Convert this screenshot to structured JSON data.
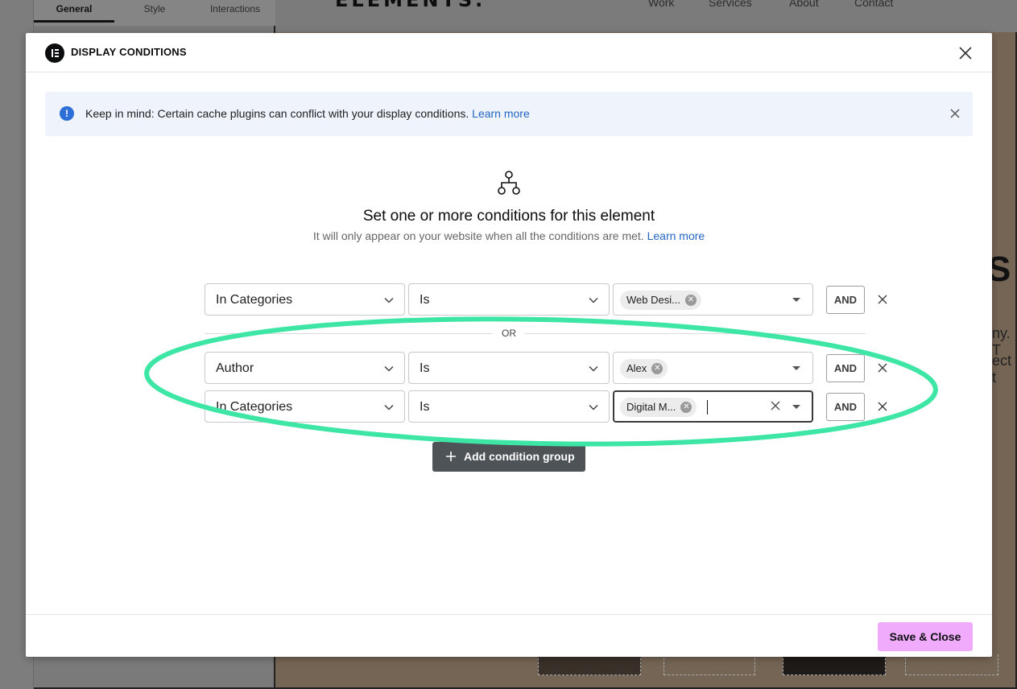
{
  "background": {
    "editor_tabs": [
      "General",
      "Style",
      "Interactions"
    ],
    "site_logo": "ELEMENTS.",
    "site_nav": [
      "Work",
      "Services",
      "About",
      "Contact"
    ],
    "site_text_big": "S",
    "site_text_line1": "ny. T",
    "site_text_line2": "ect t"
  },
  "modal": {
    "title": "DISPLAY CONDITIONS",
    "notice": {
      "text": "Keep in mind: Certain cache plugins can conflict with your display conditions.",
      "link": "Learn more"
    },
    "hero": {
      "title": "Set one or more conditions for this element",
      "subtitle": "It will only appear on your website when all the conditions are met.",
      "link": "Learn more"
    },
    "separator_label": "OR",
    "groups": [
      {
        "rows": [
          {
            "condition": "In Categories",
            "operator": "Is",
            "values": [
              "Web Desi..."
            ],
            "and_label": "AND"
          }
        ]
      },
      {
        "rows": [
          {
            "condition": "Author",
            "operator": "Is",
            "values": [
              "Alex"
            ],
            "and_label": "AND"
          },
          {
            "condition": "In Categories",
            "operator": "Is",
            "values": [
              "Digital M..."
            ],
            "and_label": "AND"
          }
        ]
      }
    ],
    "add_group_label": "Add condition group",
    "save_label": "Save & Close"
  },
  "colors": {
    "highlight_ring": "#3ee6a6",
    "save_button": "#f0abfc",
    "notice_bg": "#eef3fc",
    "link": "#2366c4"
  }
}
